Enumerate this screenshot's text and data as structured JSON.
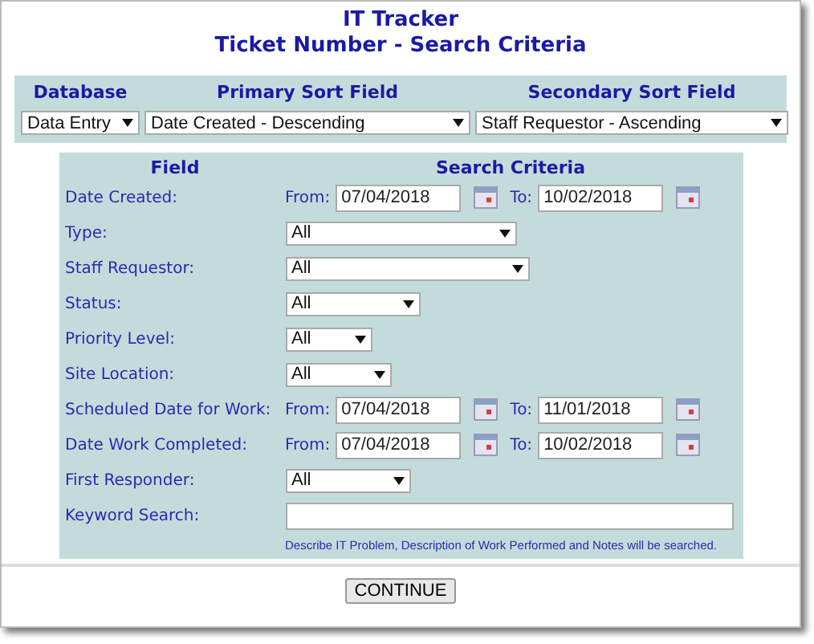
{
  "title": "IT Tracker",
  "subtitle": "Ticket Number - Search Criteria",
  "sort": {
    "columns": [
      {
        "heading": "Database",
        "value": "Data Entry"
      },
      {
        "heading": "Primary Sort Field",
        "value": "Date Created - Descending"
      },
      {
        "heading": "Secondary Sort Field",
        "value": "Staff Requestor - Ascending"
      }
    ]
  },
  "criteria": {
    "headings": [
      "Field",
      "Search Criteria"
    ],
    "rows": [
      {
        "kind": "date",
        "label": "Date Created:",
        "from_label": "From:",
        "from": "07/04/2018",
        "to_label": "To:",
        "to": "10/02/2018"
      },
      {
        "kind": "select",
        "label": "Type:",
        "value": "All"
      },
      {
        "kind": "select",
        "label": "Staff Requestor:",
        "value": "All"
      },
      {
        "kind": "select",
        "label": "Status:",
        "value": "All"
      },
      {
        "kind": "select",
        "label": "Priority Level:",
        "value": "All"
      },
      {
        "kind": "select",
        "label": "Site Location:",
        "value": "All"
      },
      {
        "kind": "date",
        "label": "Scheduled Date for Work:",
        "from_label": "From:",
        "from": "07/04/2018",
        "to_label": "To:",
        "to": "11/01/2018"
      },
      {
        "kind": "date",
        "label": "Date Work Completed:",
        "from_label": "From:",
        "from": "07/04/2018",
        "to_label": "To:",
        "to": "10/02/2018"
      },
      {
        "kind": "select",
        "label": "First Responder:",
        "value": "All"
      },
      {
        "kind": "text",
        "label": "Keyword Search:",
        "note": "Describe IT Problem, Description of Work Performed and Notes will be searched."
      }
    ]
  },
  "button": "CONTINUE"
}
